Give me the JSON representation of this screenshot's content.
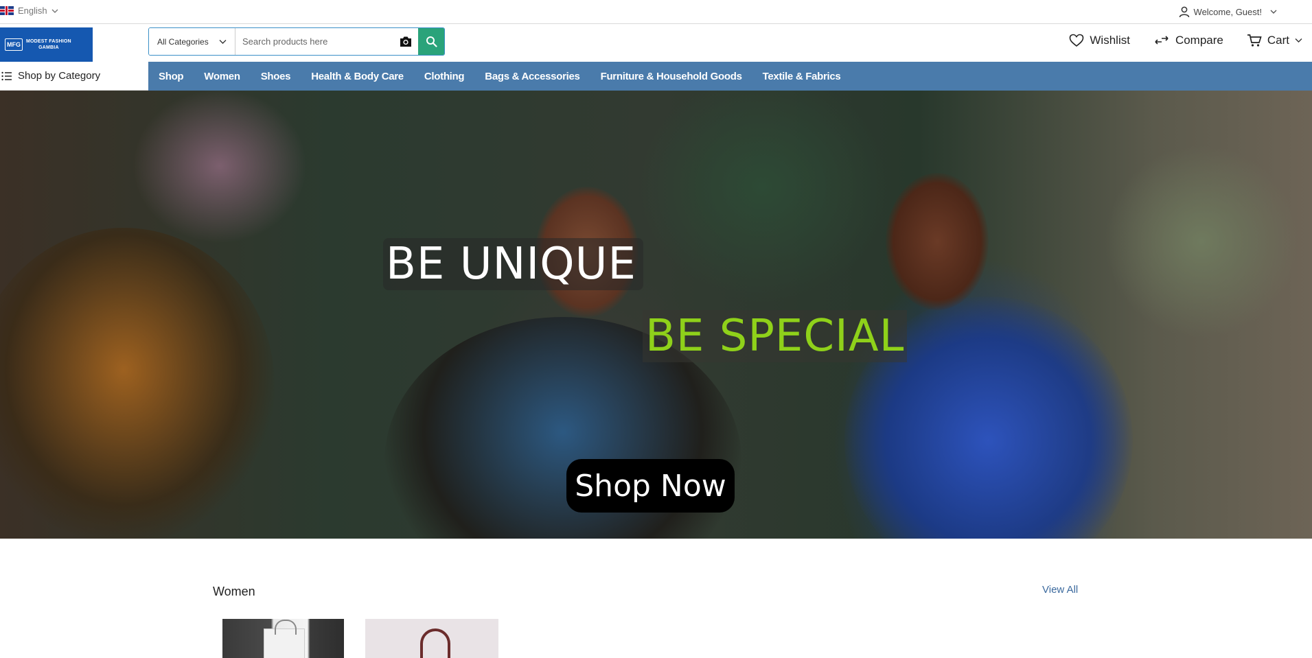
{
  "topbar": {
    "language": "English",
    "welcome": "Welcome, Guest!"
  },
  "header": {
    "logo_text_line1": "MODEST FASHION",
    "logo_text_line2": "GAMBIA",
    "logo_mark": "MFG",
    "category_select": "All Categories",
    "search_placeholder": "Search products here",
    "wishlist": "Wishlist",
    "compare": "Compare",
    "cart": "Cart"
  },
  "nav": {
    "shop_by_category": "Shop by Category",
    "items": [
      {
        "label": "Shop"
      },
      {
        "label": "Women"
      },
      {
        "label": "Shoes"
      },
      {
        "label": "Health & Body Care"
      },
      {
        "label": "Clothing"
      },
      {
        "label": "Bags & Accessories"
      },
      {
        "label": "Furniture & Household Goods"
      },
      {
        "label": "Textile & Fabrics"
      }
    ]
  },
  "hero": {
    "line1": "BE UNIQUE",
    "line2": "BE SPECIAL",
    "cta": "Shop Now"
  },
  "section": {
    "title": "Women",
    "view_all": "View All"
  },
  "icons": {
    "language_flag": "uk-flag-icon",
    "user": "user-icon",
    "camera": "camera-icon",
    "search": "search-icon",
    "wishlist": "heart-icon",
    "compare": "compare-arrows-icon",
    "cart": "cart-icon",
    "menu": "list-icon"
  },
  "colors": {
    "nav_background": "#4a7bab",
    "search_button": "#2aa37a",
    "logo_background": "#1558b0",
    "hero_special": "#8fd11a",
    "view_all_link": "#3c6a9e"
  }
}
